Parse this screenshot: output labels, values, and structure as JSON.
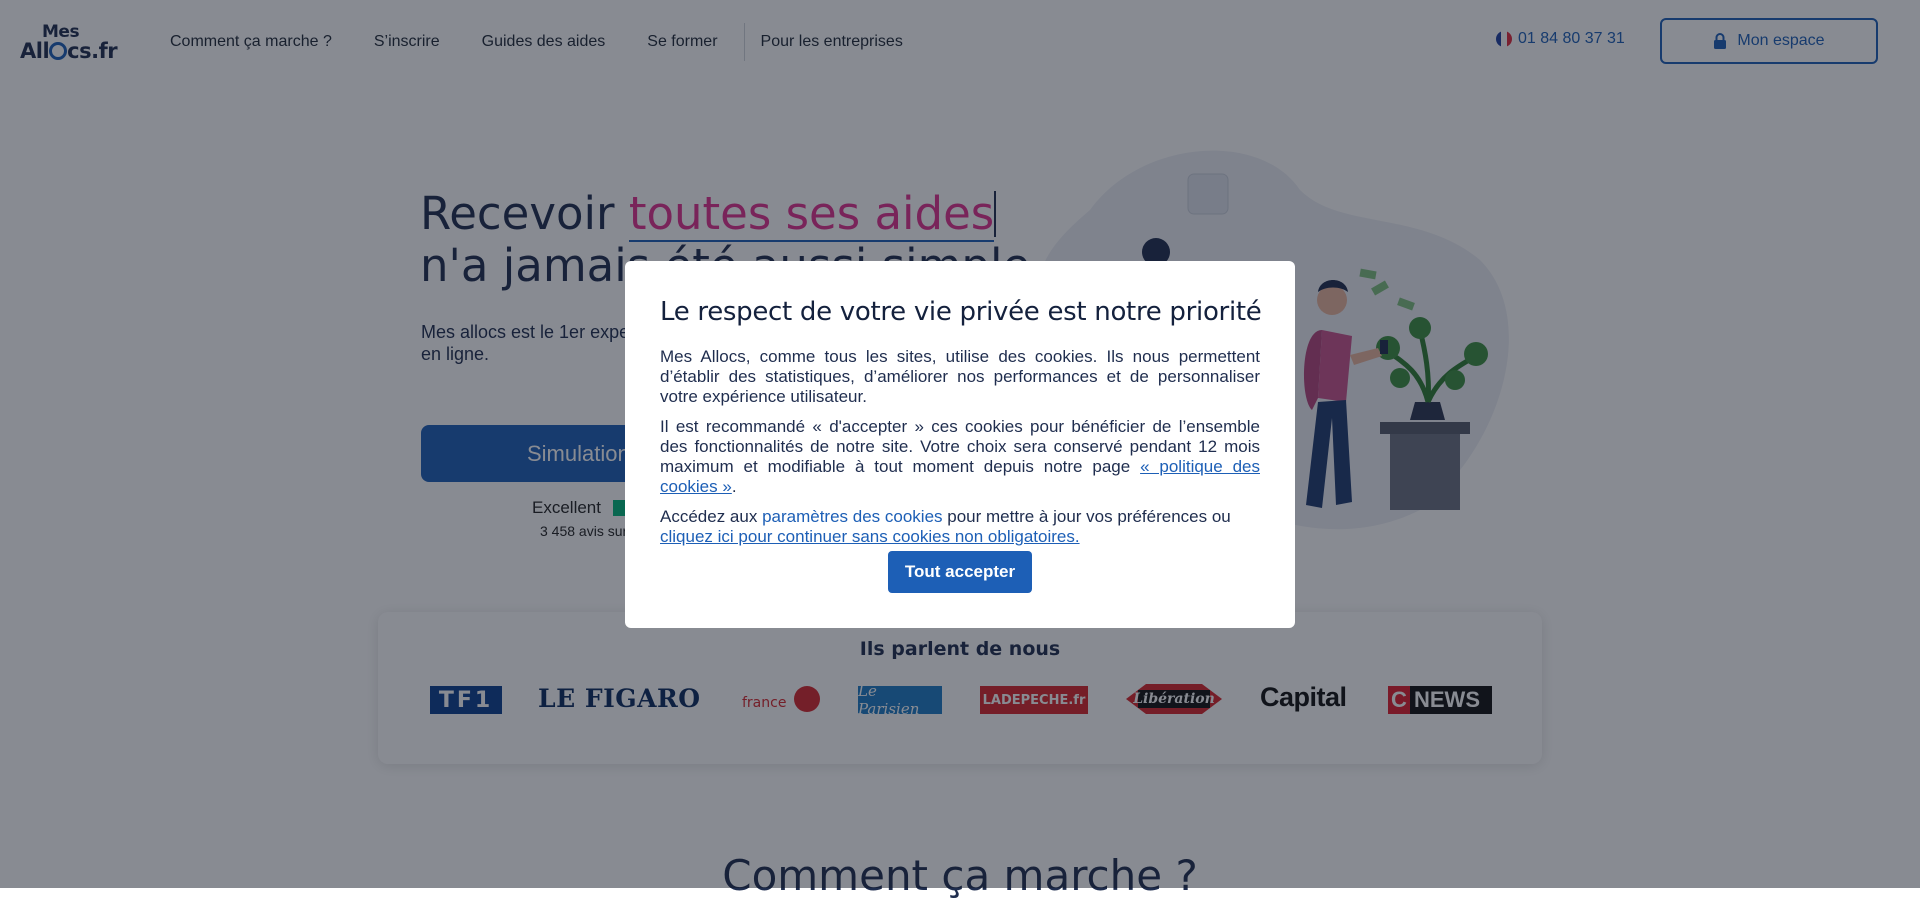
{
  "header": {
    "logo_line1": "Mes",
    "logo_line2_a": "All",
    "logo_line2_b": "cs.fr",
    "nav": [
      "Comment ça marche ?",
      "S’inscrire",
      "Guides des aides",
      "Se former",
      "Pour les entreprises"
    ],
    "phone": "01 84 80 37 31",
    "espace_label": "Mon espace"
  },
  "hero": {
    "title_part1": "Recevoir ",
    "title_accent": "toutes ses aides",
    "title_line2": "n'a jamais été aussi simple",
    "subtitle": "Mes allocs est le 1er expert des aides sociales pour les particuliers, 100% en ligne.",
    "cta_label": "Simulation gratuite",
    "trustpilot_rating": "Excellent",
    "trustpilot_reviews": "3 458 avis sur Trustpilot"
  },
  "press": {
    "title": "Ils parlent de nous",
    "logos": {
      "tf1": "TF1",
      "figaro": "LE FIGARO",
      "ouest1": "ouest",
      "ouest2": "france",
      "parisien": "Le Parisien",
      "depeche": "LADEPECHE.fr",
      "liberation": "Libération",
      "capital": "Capital",
      "cnews_c": "C",
      "cnews": "NEWS"
    }
  },
  "section_title": "Comment ça marche ?",
  "cookie_modal": {
    "title": "Le respect de votre vie privée est notre priorité",
    "p1": "Mes Allocs, comme tous les sites, utilise des cookies. Ils nous permettent d’établir des statistiques, d’améliorer nos performances et de personnaliser votre expérience utilisateur.",
    "p2_text": "Il est recommandé « d'accepter » ces cookies pour bénéficier de l’ensemble des fonctionnalités de notre site. Votre choix sera conservé pendant 12 mois maximum et modifiable à tout moment depuis notre page ",
    "p2_link": "« politique des cookies »",
    "p2_end": ".",
    "p3_text1": "Accédez aux ",
    "p3_link1": "paramètres des cookies",
    "p3_text2": " pour mettre à jour vos préférences ou ",
    "p3_link2": "cliquez ici pour continuer sans cookies non obligatoires.",
    "accept_label": "Tout accepter"
  },
  "colors": {
    "brand_blue": "#1d5fb6",
    "accent_pink": "#e0308e",
    "navy": "#1f2d4e",
    "overlay": "rgba(18,24,38,0.5)"
  }
}
